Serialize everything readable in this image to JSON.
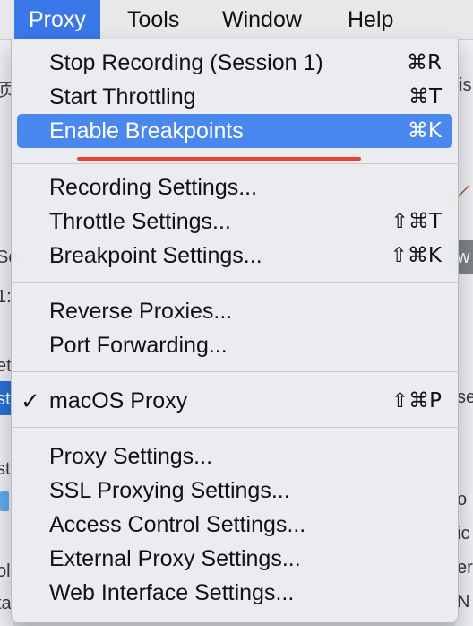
{
  "menubar": {
    "items": [
      {
        "label": "Proxy",
        "active": true
      },
      {
        "label": "Tools"
      },
      {
        "label": "Window"
      },
      {
        "label": "Help"
      }
    ]
  },
  "proxy_menu": {
    "groups": [
      [
        {
          "label": "Stop Recording (Session 1)",
          "shortcut": "⌘R"
        },
        {
          "label": "Start Throttling",
          "shortcut": "⌘T"
        },
        {
          "label": "Enable Breakpoints",
          "shortcut": "⌘K",
          "highlighted": true
        }
      ],
      [
        {
          "label": "Recording Settings...",
          "shortcut": ""
        },
        {
          "label": "Throttle Settings...",
          "shortcut": "⇧⌘T"
        },
        {
          "label": "Breakpoint Settings...",
          "shortcut": "⇧⌘K"
        }
      ],
      [
        {
          "label": "Reverse Proxies...",
          "shortcut": ""
        },
        {
          "label": "Port Forwarding...",
          "shortcut": ""
        }
      ],
      [
        {
          "label": "macOS Proxy",
          "shortcut": "⇧⌘P",
          "checked": true,
          "check_glyph": "✓"
        }
      ],
      [
        {
          "label": "Proxy Settings...",
          "shortcut": ""
        },
        {
          "label": "SSL Proxying Settings...",
          "shortcut": ""
        },
        {
          "label": "Access Control Settings...",
          "shortcut": ""
        },
        {
          "label": "External Proxy Settings...",
          "shortcut": ""
        },
        {
          "label": "Web Interface Settings...",
          "shortcut": ""
        }
      ]
    ]
  },
  "colors": {
    "highlight": "#4a88f0",
    "menubar_active": "#3a78ea",
    "annotation": "#e5432f"
  },
  "background_fragments": {
    "left": [
      "页",
      "Se",
      "1:",
      "et",
      "st",
      "st",
      "ol",
      "ta"
    ],
    "right": [
      "is",
      "w",
      "se",
      "o",
      "ic",
      "er",
      "N"
    ]
  },
  "icons": {
    "check": "checkmark-icon",
    "broom": "broom-icon"
  }
}
